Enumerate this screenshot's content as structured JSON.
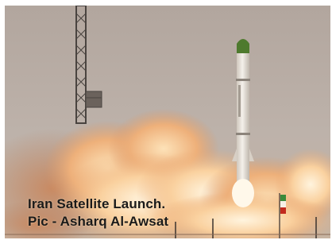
{
  "photo": {
    "subject": "rocket launch",
    "caption_line1": "Iran Satellite Launch.",
    "caption_line2": "Pic - Asharq Al-Awsat"
  },
  "colors": {
    "sky": "#b5aaa3",
    "smoke": "#f1c392",
    "flame": "#fbeed1",
    "rocket_body": "#e9e4dc",
    "rocket_nose": "#4e7a2e",
    "flag_red": "#c22a1e"
  }
}
